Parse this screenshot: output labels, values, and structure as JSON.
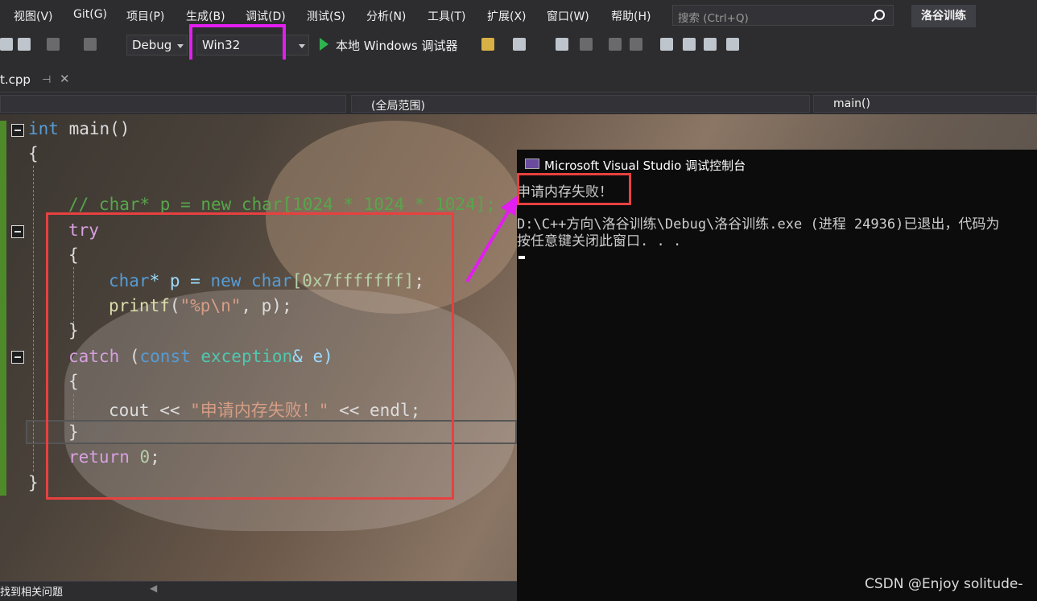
{
  "menu": [
    "视图(V)",
    "Git(G)",
    "项目(P)",
    "生成(B)",
    "调试(D)",
    "测试(S)",
    "分析(N)",
    "工具(T)",
    "扩展(X)",
    "窗口(W)",
    "帮助(H)"
  ],
  "search": {
    "placeholder": "搜索 (Ctrl+Q)"
  },
  "solution_name": "洛谷训练",
  "toolbar": {
    "config": "Debug",
    "platform": "Win32",
    "run_label": "本地 Windows 调试器"
  },
  "tab": {
    "file": "t.cpp"
  },
  "nav": {
    "scope": "(全局范围)",
    "member": "main()"
  },
  "code": {
    "l1_int": "int",
    "l1_main": " main()",
    "l2": "{",
    "l3": "// char* p = new char[1024 * 1024 * 1024];",
    "l4": "try",
    "l5": "{",
    "l6_char": "char",
    "l6_p": "* p = ",
    "l6_new": "new",
    "l6_char2": " char",
    "l6_num": "[0x7fffffff]",
    "l6_end": ";",
    "l7_fn": "printf",
    "l7_open": "(",
    "l7_str": "\"%p\\n\"",
    "l7_rest": ", p);",
    "l8": "}",
    "l9_catch": "catch",
    "l9_open": " (",
    "l9_const": "const",
    "l9_exc": " exception",
    "l9_rest": "& e)",
    "l10": "{",
    "l11_cout": "cout << ",
    "l11_str": "\"申请内存失败！\"",
    "l11_rest": " << endl;",
    "l12": "}",
    "l13_ret": "return",
    "l13_num": " 0",
    "l13_end": ";",
    "l14": "}"
  },
  "console": {
    "title": "Microsoft Visual Studio 调试控制台",
    "line1": "申请内存失败！",
    "line2": "D:\\C++方向\\洛谷训练\\Debug\\洛谷训练.exe (进程 24936)已退出，代码为",
    "line3": "按任意键关闭此窗口. . ."
  },
  "status": {
    "text": "找到相关问题"
  },
  "watermark": "CSDN @Enjoy solitude-",
  "colors": {
    "highlight_magenta": "#e21ef0",
    "highlight_red": "#e84040",
    "run_green": "#2fb34f"
  }
}
